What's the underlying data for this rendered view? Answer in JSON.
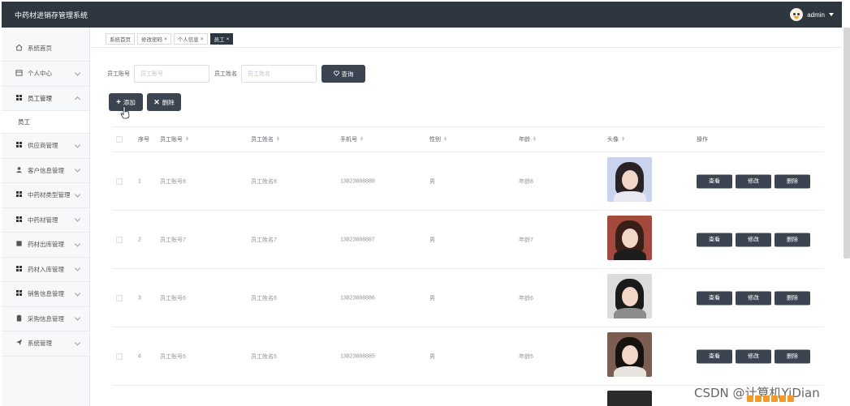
{
  "app": {
    "title": "中药材进销存管理系统",
    "user": "admin"
  },
  "sidebar": {
    "items": [
      {
        "label": "系统首页",
        "icon": "home-icon"
      },
      {
        "label": "个人中心",
        "icon": "calendar-icon"
      },
      {
        "label": "员工管理",
        "icon": "grid-icon",
        "expanded": true
      },
      {
        "label": "员工",
        "sub": true
      },
      {
        "label": "供应商管理",
        "icon": "grid-icon"
      },
      {
        "label": "客户信息管理",
        "icon": "user-icon"
      },
      {
        "label": "中药材类型管理",
        "icon": "grid-icon"
      },
      {
        "label": "中药材管理",
        "icon": "grid-icon"
      },
      {
        "label": "药材出库管理",
        "icon": "square-icon"
      },
      {
        "label": "药材入库管理",
        "icon": "grid-icon"
      },
      {
        "label": "销售信息管理",
        "icon": "grid-icon"
      },
      {
        "label": "采购信息管理",
        "icon": "clipboard-icon"
      },
      {
        "label": "系统管理",
        "icon": "send-icon"
      }
    ]
  },
  "tabs": [
    {
      "label": "系统首页",
      "closable": false
    },
    {
      "label": "修改密码",
      "closable": true
    },
    {
      "label": "个人信息",
      "closable": true
    },
    {
      "label": "员工",
      "closable": true,
      "active": true
    }
  ],
  "search": {
    "account_label": "员工账号",
    "account_placeholder": "员工账号",
    "name_label": "员工姓名",
    "name_placeholder": "员工姓名",
    "query_label": "查询"
  },
  "actions": {
    "add_label": "添加",
    "delete_label": "删除"
  },
  "table": {
    "headers": {
      "index": "序号",
      "account": "员工账号",
      "name": "员工姓名",
      "phone": "手机号",
      "sex": "性别",
      "age": "年龄",
      "avatar": "头像",
      "ops": "操作"
    },
    "rows": [
      {
        "index": "1",
        "account": "员工账号8",
        "name": "员工姓名8",
        "phone": "13823888888",
        "sex": "男",
        "age": "年龄8"
      },
      {
        "index": "2",
        "account": "员工账号7",
        "name": "员工姓名7",
        "phone": "13823888887",
        "sex": "男",
        "age": "年龄7"
      },
      {
        "index": "3",
        "account": "员工账号6",
        "name": "员工姓名6",
        "phone": "13823888886",
        "sex": "男",
        "age": "年龄6"
      },
      {
        "index": "4",
        "account": "员工账号5",
        "name": "员工姓名5",
        "phone": "13823888885",
        "sex": "男",
        "age": "年龄5"
      }
    ],
    "row_actions": {
      "view": "查看",
      "edit": "修改",
      "delete": "删除"
    }
  },
  "watermark": "CSDN @计算机YiDian",
  "colors": {
    "topbar": "#2e3640",
    "button": "#3b4450",
    "sidebar_bg": "#f7f8fa"
  }
}
